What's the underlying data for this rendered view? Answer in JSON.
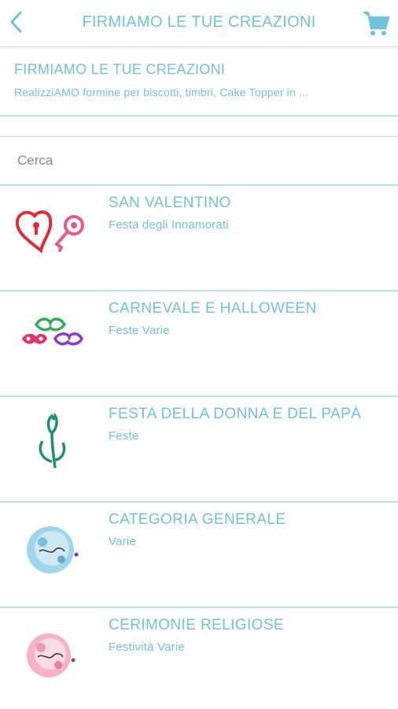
{
  "header": {
    "title": "FIRMIAMO LE TUE CREAZIONI",
    "back_icon": "chevron-left-icon",
    "cart_icon": "cart-icon",
    "accent_color": "#6fc3d9"
  },
  "shop": {
    "name": "FIRMIAMO LE TUE CREAZIONI",
    "description": "RealizziAMO formine per biscotti, timbri, Cake Topper in ..."
  },
  "search": {
    "placeholder": "Cerca"
  },
  "categories": [
    {
      "title": "SAN VALENTINO",
      "subtitle": "Festa degli Innamorati",
      "icon": "hearts-keys-image"
    },
    {
      "title": "CARNEVALE E HALLOWEEN",
      "subtitle": "Feste Varie",
      "icon": "masks-image"
    },
    {
      "title": "FESTA DELLA DONNA E DEL PAPÀ",
      "subtitle": "Feste",
      "icon": "tulip-image"
    },
    {
      "title": "CATEGORIA GENERALE",
      "subtitle": "Varie",
      "icon": "blue-seal-logo"
    },
    {
      "title": "CERIMONIE RELIGIOSE",
      "subtitle": "Festività Varie",
      "icon": "pink-seal-logo"
    }
  ]
}
